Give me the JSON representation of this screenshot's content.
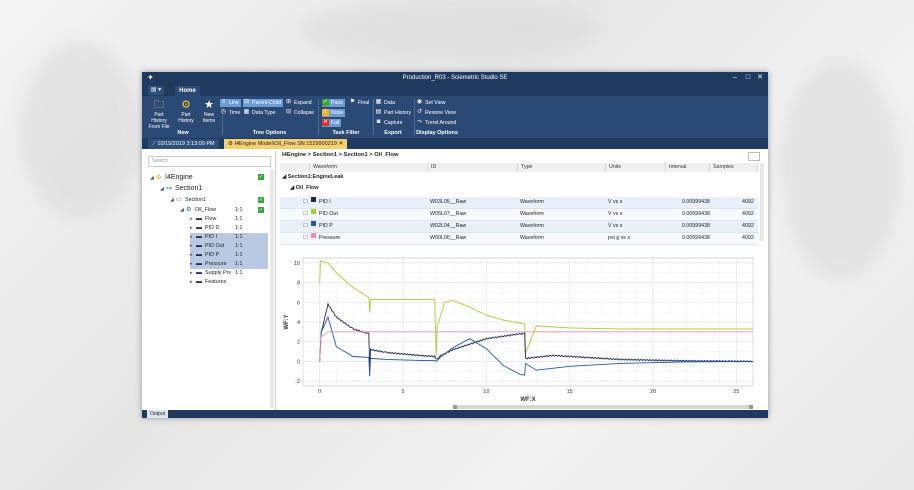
{
  "window": {
    "title": "Production_R03 - Sciemetric Studio SE"
  },
  "menu": {
    "file_icon": "grid-icon",
    "home_tab": "Home"
  },
  "ribbon": {
    "new_group": {
      "label": "New",
      "part_history_from_file": "Part History\nFrom File",
      "part_history": "Part\nHistory",
      "new_items": "New\nItems"
    },
    "tree_options": {
      "label": "Tree Options",
      "line": "Line",
      "time": "Time",
      "parent_child": "Parent-Child",
      "data_type": "Data Type",
      "expand": "Expand",
      "collapse": "Collapse"
    },
    "task_filter": {
      "label": "Task Filter",
      "pass": "Pass",
      "final": "Final",
      "none": "None",
      "fail": "Fail"
    },
    "export": {
      "label": "Export",
      "data": "Data",
      "part_history": "Part History",
      "capture": "Capture"
    },
    "display_options": {
      "label": "Display Options",
      "set_view": "Set View",
      "restore_view": "Restore View",
      "trend_around": "Trend Around"
    }
  },
  "tabs": [
    {
      "label": "10/15/2019 3:13:09 PM"
    },
    {
      "label": "I4Engine Model\\Oil_Flow SN:1529900219"
    }
  ],
  "left_panel": {
    "search_placeholder": "Search",
    "tree": [
      {
        "label": "I4Engine",
        "ratio": ""
      },
      {
        "label": "Section1",
        "ratio": ""
      },
      {
        "label": "Section1",
        "ratio": ""
      },
      {
        "label": "Oil_Flow",
        "ratio": "1:1"
      },
      {
        "label": "Flow",
        "ratio": "1:1"
      },
      {
        "label": "PID D",
        "ratio": "1:1"
      },
      {
        "label": "PID I",
        "ratio": "1:1"
      },
      {
        "label": "PID Out",
        "ratio": "1:1"
      },
      {
        "label": "PID P",
        "ratio": "1:1"
      },
      {
        "label": "Pressure",
        "ratio": "1:1"
      },
      {
        "label": "Supply Prs",
        "ratio": "1:1"
      },
      {
        "label": "Features",
        "ratio": ""
      }
    ]
  },
  "breadcrumb": "I4Engine > Section1 > Section1 > Oil_Flow",
  "grid": {
    "columns": [
      "Waveform",
      "ID",
      "Type",
      "Units",
      "Interval",
      "Samples"
    ],
    "group1": "Section1:EngineLeak",
    "group2": "Oil_Flow",
    "rows": [
      {
        "name": "PID I",
        "id": "W03L05__Raw",
        "type": "Waveform",
        "units": "V vs s",
        "interval": "0.00999438",
        "samples": "4092",
        "color": "#1c2a4a"
      },
      {
        "name": "PID Out",
        "id": "W05L07__Raw",
        "type": "Waveform",
        "units": "V vs s",
        "interval": "0.00999438",
        "samples": "4092",
        "color": "#a5cf2a"
      },
      {
        "name": "PID P",
        "id": "W02L04__Raw",
        "type": "Waveform",
        "units": "V vs s",
        "interval": "0.00999438",
        "samples": "4092",
        "color": "#2456a6"
      },
      {
        "name": "Pressure",
        "id": "W00L00__Raw",
        "type": "Waveform",
        "units": "psi g vs s",
        "interval": "0.00999438",
        "samples": "4092",
        "color": "#f08cb0"
      }
    ]
  },
  "status": {
    "output_tab": "Output"
  },
  "chart_data": {
    "type": "line",
    "xlabel": "WF:X",
    "ylabel": "WF:Y",
    "xlim": [
      -1,
      26
    ],
    "ylim": [
      -2.5,
      10.5
    ],
    "xticks": [
      0,
      5,
      10,
      15,
      20,
      25
    ],
    "yticks": [
      -2,
      0,
      2,
      4,
      6,
      8,
      10
    ],
    "grid": true,
    "series": [
      {
        "name": "PID Out",
        "color": "#a5cf2a",
        "x": [
          0,
          0.05,
          0.5,
          1,
          2,
          2.95,
          3,
          3.05,
          4,
          6,
          6.9,
          7,
          7.05,
          7.5,
          8,
          9,
          10,
          11,
          12,
          12.3,
          12.35,
          13,
          15,
          18,
          22,
          26
        ],
        "y": [
          8,
          10.2,
          10,
          9,
          7.5,
          6.5,
          5,
          6.3,
          6.3,
          6.3,
          6.3,
          0.5,
          3.5,
          6,
          6.2,
          5.5,
          4.7,
          4.2,
          3.9,
          3.8,
          0.8,
          3.6,
          3.4,
          3.3,
          3.3,
          3.3
        ]
      },
      {
        "name": "PID I",
        "color": "#1c2a4a",
        "x": [
          0,
          0.1,
          0.5,
          1,
          2,
          2.95,
          3,
          3.05,
          4,
          6,
          6.9,
          7,
          7.3,
          8,
          10,
          12,
          12.3,
          12.35,
          14,
          18,
          22,
          26
        ],
        "y": [
          0,
          3,
          5.8,
          4.5,
          3.3,
          2.8,
          -1,
          1.2,
          0.9,
          0.6,
          0.5,
          0.2,
          0.6,
          1.2,
          2.3,
          2.8,
          2.8,
          0.3,
          0.6,
          0.2,
          0.05,
          0
        ],
        "noise": true
      },
      {
        "name": "PID P",
        "color": "#2456a6",
        "x": [
          0,
          0.1,
          0.5,
          1,
          2,
          2.95,
          3,
          3.05,
          4,
          6,
          6.9,
          7,
          7.3,
          8,
          9,
          10,
          11,
          12,
          12.3,
          12.35,
          13,
          15,
          18,
          22,
          26
        ],
        "y": [
          0,
          3,
          4.5,
          1.5,
          0.5,
          0.4,
          -1.5,
          0.3,
          0.2,
          0.1,
          0.1,
          0,
          0.5,
          1.4,
          2.3,
          1.3,
          -0.4,
          -1.3,
          -1.4,
          -0.2,
          -0.9,
          -0.5,
          -0.2,
          -0.05,
          0
        ]
      },
      {
        "name": "Pressure",
        "color": "#f08cb0",
        "x": [
          0,
          0.1,
          0.5,
          1,
          3,
          26
        ],
        "y": [
          0,
          2.5,
          3,
          3,
          3,
          3
        ]
      }
    ]
  }
}
